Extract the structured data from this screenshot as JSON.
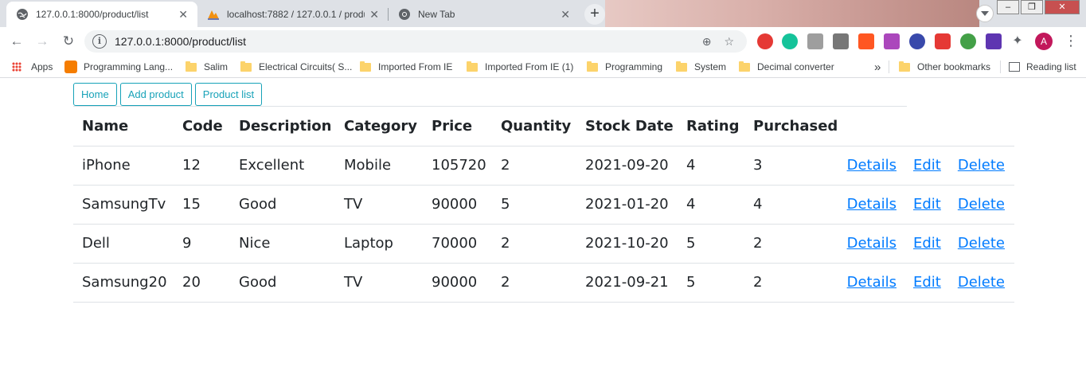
{
  "browser": {
    "tabs": [
      {
        "title": "127.0.0.1:8000/product/list",
        "active": true,
        "icon": "globe-icon"
      },
      {
        "title": "localhost:7882 / 127.0.0.1 / produ",
        "active": false,
        "icon": "phpmyadmin-icon"
      },
      {
        "title": "New Tab",
        "active": false,
        "icon": "chrome-icon"
      }
    ],
    "new_tab_label": "+",
    "url": "127.0.0.1:8000/product/list",
    "avatar_letter": "A",
    "window_buttons": {
      "minimize": "–",
      "restore": "❐",
      "close": "✕"
    }
  },
  "bookmarks": {
    "items": [
      {
        "label": "Apps",
        "icon": "apps-grid-icon"
      },
      {
        "label": "Programming Lang...",
        "icon": "blogger-icon"
      },
      {
        "label": "Salim",
        "icon": "folder-icon"
      },
      {
        "label": "Electrical Circuits( S...",
        "icon": "folder-icon"
      },
      {
        "label": "Imported From IE",
        "icon": "folder-icon"
      },
      {
        "label": "Imported From IE (1)",
        "icon": "folder-icon"
      },
      {
        "label": "Programming",
        "icon": "folder-icon"
      },
      {
        "label": "System",
        "icon": "folder-icon"
      },
      {
        "label": "Decimal converter",
        "icon": "folder-icon"
      }
    ],
    "overflow": "»",
    "other": "Other bookmarks",
    "reading_list": "Reading list"
  },
  "page": {
    "nav": [
      {
        "label": "Home"
      },
      {
        "label": "Add product"
      },
      {
        "label": "Product list"
      }
    ],
    "table": {
      "headers": [
        "Name",
        "Code",
        "Description",
        "Category",
        "Price",
        "Quantity",
        "Stock Date",
        "Rating",
        "Purchased"
      ],
      "action_labels": {
        "details": "Details",
        "edit": "Edit",
        "delete": "Delete"
      },
      "rows": [
        {
          "name": "iPhone",
          "code": "12",
          "description": "Excellent",
          "category": "Mobile",
          "price": "105720",
          "quantity": "2",
          "stock_date": "2021-09-20",
          "rating": "4",
          "purchased": "3"
        },
        {
          "name": "SamsungTv",
          "code": "15",
          "description": "Good",
          "category": "TV",
          "price": "90000",
          "quantity": "5",
          "stock_date": "2021-01-20",
          "rating": "4",
          "purchased": "4"
        },
        {
          "name": "Dell",
          "code": "9",
          "description": "Nice",
          "category": "Laptop",
          "price": "70000",
          "quantity": "2",
          "stock_date": "2021-10-20",
          "rating": "5",
          "purchased": "2"
        },
        {
          "name": "Samsung20",
          "code": "20",
          "description": "Good",
          "category": "TV",
          "price": "90000",
          "quantity": "2",
          "stock_date": "2021-09-21",
          "rating": "5",
          "purchased": "2"
        }
      ]
    },
    "colors": {
      "link": "#007bff",
      "nav_button": "#17a2b8"
    }
  }
}
